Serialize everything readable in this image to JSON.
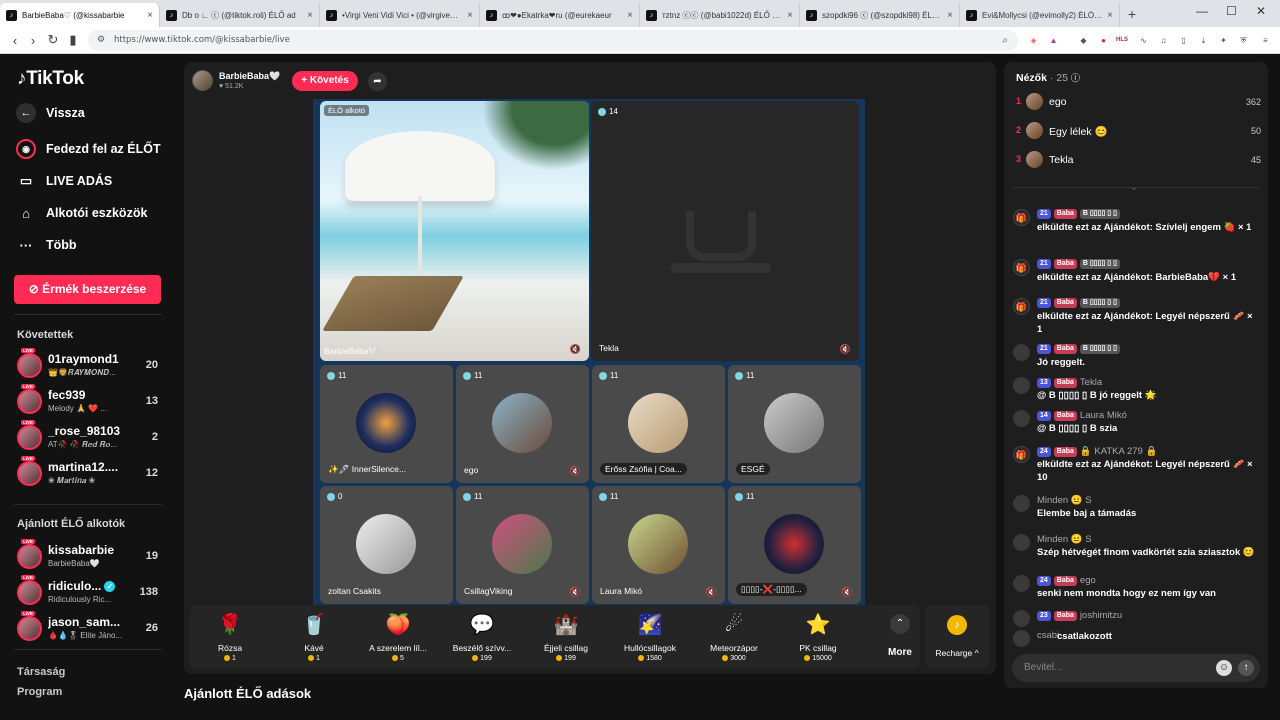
{
  "browser": {
    "tabs": [
      {
        "title": "BarbieBaba♡ (@kissabarbie",
        "active": true
      },
      {
        "title": "Db o ∟ ⓒ (@tiktok.roli) ÉLŐ ad",
        "active": false
      },
      {
        "title": "•Virgi Veni Vidi Vici • (@virgivenivic",
        "active": false
      },
      {
        "title": "ꝏ❤●Ekatrka❤ru (@eurekaeur",
        "active": false
      },
      {
        "title": "тztnz ⓒⓒ (@babi1022d) ÉLŐ adás",
        "active": false
      },
      {
        "title": "szopdki96 ⓒ (@szopdki98) ÉLŐ adás",
        "active": false
      },
      {
        "title": "Evi&Mollycsi (@evimolly2) ÉLŐ adá",
        "active": false
      }
    ],
    "url": "https://www.tiktok.com/@kissabarbie/live",
    "new_tab": "+"
  },
  "sidebar": {
    "logo": "TikTok",
    "back": "Vissza",
    "nav": [
      {
        "label": "Fedezd fel az ÉLŐT",
        "icon": "live-explore-icon"
      },
      {
        "label": "LIVE ADÁS",
        "icon": "camera-icon"
      },
      {
        "label": "Alkotói eszközök",
        "icon": "home-icon"
      },
      {
        "label": "Több",
        "icon": "more-dots-icon"
      }
    ],
    "coin_button": "Érmék beszerzése",
    "following_title": "Követettek",
    "following": [
      {
        "name": "01raymond1",
        "sub": "👑🦁𝑹𝑨𝒀𝑴𝑶𝑵𝑫...",
        "count": "20"
      },
      {
        "name": "fec939",
        "sub": "Melody 🙏 ❤️ ...",
        "count": "13"
      },
      {
        "name": "_rose_98103",
        "sub": "AT🥀 🥀 𝑹𝒆𝒅 𝑹𝒐...",
        "count": "2"
      },
      {
        "name": "martina12....",
        "sub": "❀ 𝑴𝒂𝒓𝒕𝒊𝒏𝒂 ❀",
        "count": "12"
      }
    ],
    "suggested_title": "Ajánlott ÉLŐ alkotók",
    "suggested": [
      {
        "name": "kissabarbie",
        "sub": "BarbieBaba🤍",
        "count": "19",
        "verified": false
      },
      {
        "name": "ridiculo...",
        "sub": "Ridiculously Ric...",
        "count": "138",
        "verified": true
      },
      {
        "name": "jason_sam...",
        "sub": "🩸💧🎖 Elite Jáno...",
        "count": "26",
        "verified": false
      }
    ],
    "footer": [
      "Társaság",
      "Program"
    ]
  },
  "host": {
    "name": "BarbieBaba🤍",
    "likes": "♥ 51.2K",
    "follow": "+ Követés"
  },
  "stage": {
    "main_tiles": [
      {
        "name": "BarbieBaba🤍",
        "count": "",
        "badge": "ÉLŐ alkotó"
      },
      {
        "name": "Tekla",
        "count": "14"
      }
    ],
    "guest_tiles": [
      {
        "name": "✨🖊 InnerSilence...",
        "count": "11"
      },
      {
        "name": "ego",
        "count": "11"
      },
      {
        "name": "Erőss Zsófia | Coa...",
        "count": "11"
      },
      {
        "name": "ESGÉ",
        "count": "11"
      },
      {
        "name": "zoltan Csakits",
        "count": "0"
      },
      {
        "name": "CsillagViking",
        "count": "11"
      },
      {
        "name": "Laura Mikó",
        "count": "11"
      },
      {
        "name": "▯▯▯▯-❌-▯▯▯▯...",
        "count": "11"
      }
    ]
  },
  "gifts": [
    {
      "name": "Rózsa",
      "price": "1",
      "icon": "rose-icon"
    },
    {
      "name": "Kávé",
      "price": "1",
      "icon": "coffee-icon"
    },
    {
      "name": "A szerelem líl...",
      "price": "5",
      "icon": "heart-potion-icon"
    },
    {
      "name": "Beszélő szívv...",
      "price": "199",
      "icon": "talking-heart-icon"
    },
    {
      "name": "Éjjeli csillag",
      "price": "199",
      "icon": "night-star-icon"
    },
    {
      "name": "Hullócsillagok",
      "price": "1580",
      "icon": "shooting-stars-icon"
    },
    {
      "name": "Meteorzápor",
      "price": "3000",
      "icon": "meteor-icon"
    },
    {
      "name": "PK csillag",
      "price": "15000",
      "icon": "pk-star-icon"
    }
  ],
  "gift_more": "More",
  "recharge": "Recharge ^",
  "recommended_title": "Ajánlott ÉLŐ adások",
  "chat": {
    "viewers_label": "Nézők",
    "viewers_count": "· 25",
    "top": [
      {
        "rank": "1",
        "name": "ego",
        "score": "362"
      },
      {
        "rank": "2",
        "name": "Egy lélek 😊",
        "score": "50"
      },
      {
        "rank": "3",
        "name": "Tekla",
        "score": "45"
      }
    ],
    "messages": [
      {
        "lv": "21",
        "fan": "Baba",
        "user": "",
        "text": "elküldte ezt az Ajándékot: Szívlelj engem 🍓 × 1",
        "gift": true
      },
      {
        "lv": "21",
        "fan": "Baba",
        "user": "",
        "text": "elküldte ezt az Ajándékot: BarbieBaba💔 × 1",
        "gift": true
      },
      {
        "lv": "21",
        "fan": "Baba",
        "user": "",
        "text": "elküldte ezt az Ajándékot: Legyél népszerű 🥓 × 1",
        "gift": true
      },
      {
        "lv": "21",
        "fan": "Baba",
        "user": "",
        "text": "Jó reggelt.",
        "gift": false
      },
      {
        "lv": "13",
        "fan": "Baba",
        "user": "Tekla",
        "text": "@ B ▯▯▯▯ ▯ B jó reggelt 🌟",
        "gift": false
      },
      {
        "lv": "14",
        "fan": "Baba",
        "user": "Laura Mikó",
        "text": "@ B ▯▯▯▯ ▯ B szia",
        "gift": false
      },
      {
        "lv": "24",
        "fan": "Baba",
        "user": "🔒 KATKA 279 🔒",
        "text": "elküldte ezt az Ajándékot: Legyél népszerű 🥓 × 10",
        "gift": true
      },
      {
        "lv": "",
        "fan": "",
        "user": "Minden 😐 S",
        "text": "Elembe baj a támadás",
        "gift": false
      },
      {
        "lv": "",
        "fan": "",
        "user": "Minden 😐 S",
        "text": "Szép hétvégét finom vadkörtét szia sziasztok 😊",
        "gift": false
      },
      {
        "lv": "24",
        "fan": "Baba",
        "user": "ego",
        "text": "senki nem mondta hogy ez nem így van",
        "gift": false
      },
      {
        "lv": "23",
        "fan": "Baba",
        "user": "joshimitzu",
        "text": "",
        "gift": false
      },
      {
        "lv": "",
        "fan": "",
        "user": "csabi",
        "text": "csatlakozott",
        "gift": false
      }
    ],
    "input_placeholder": "Bevitel..."
  },
  "colors": {
    "accent": "#fe2c55",
    "stage_bg": "#16355a",
    "level_badge": "#4a56d6"
  }
}
